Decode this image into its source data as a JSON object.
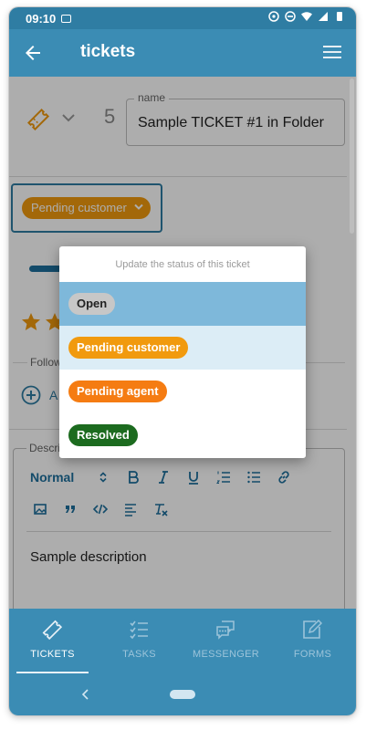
{
  "status_bar": {
    "time": "09:10"
  },
  "app_bar": {
    "title": "tickets"
  },
  "ticket": {
    "number": "5",
    "name_label": "name",
    "name_value": "Sample TICKET #1 in Folder",
    "status": "Pending customer",
    "rating_stars_visible": 2,
    "followers_label": "Follow",
    "add_follower_label": "A",
    "description_label": "Descri",
    "description_text": "Sample description"
  },
  "editor_toolbar": {
    "format": "Normal"
  },
  "dialog": {
    "title": "Update the status of this ticket",
    "options": [
      {
        "label": "Open",
        "chip_bg": "#c7c7c7",
        "chip_fg": "#222222",
        "row_bg": "#7eb8da"
      },
      {
        "label": "Pending customer",
        "chip_bg": "#f19a0e",
        "chip_fg": "#ffffff",
        "row_bg": "#dcedf6"
      },
      {
        "label": "Pending agent",
        "chip_bg": "#f57c12",
        "chip_fg": "#ffffff",
        "row_bg": "#ffffff"
      },
      {
        "label": "Resolved",
        "chip_bg": "#1c6b1f",
        "chip_fg": "#ffffff",
        "row_bg": "#ffffff"
      }
    ]
  },
  "bottom_nav": {
    "items": [
      {
        "label": "TICKETS",
        "icon": "ticket-icon",
        "active": true
      },
      {
        "label": "TASKS",
        "icon": "tasks-icon",
        "active": false
      },
      {
        "label": "MESSENGER",
        "icon": "messenger-icon",
        "active": false
      },
      {
        "label": "FORMS",
        "icon": "forms-icon",
        "active": false
      }
    ]
  },
  "colors": {
    "primary": "#3b8cb4",
    "primary_dark": "#2f7da3",
    "accent": "#f19a0e"
  }
}
